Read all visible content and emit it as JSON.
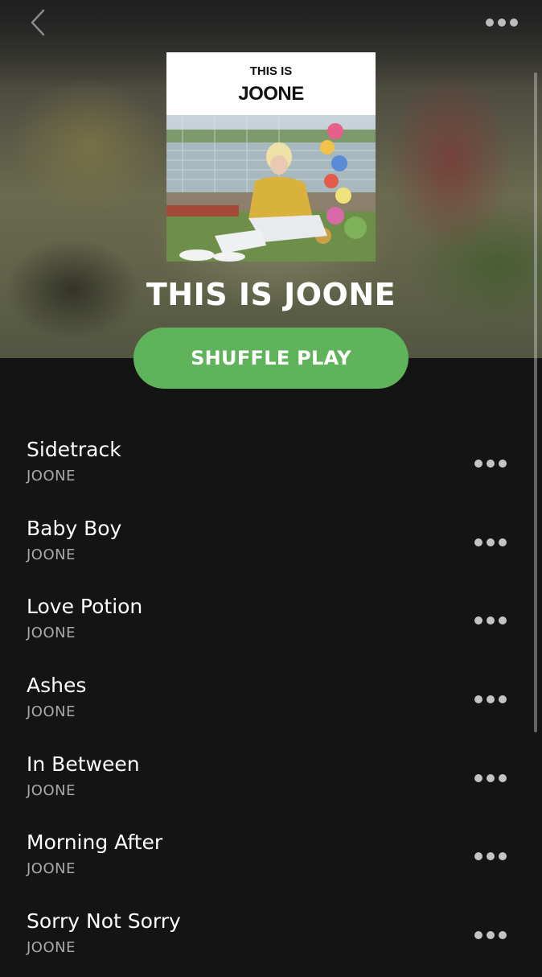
{
  "header": {
    "back_icon": "chevron-left-icon",
    "more_icon": "more-horizontal-icon"
  },
  "cover": {
    "line1": "THIS IS",
    "line2": "JOONE"
  },
  "playlist": {
    "title": "THIS IS JOONE",
    "shuffle_label": "SHUFFLE PLAY",
    "accent_color": "#5fb35b"
  },
  "tracks": [
    {
      "title": "Sidetrack",
      "artist": "JOONE"
    },
    {
      "title": "Baby Boy",
      "artist": "JOONE"
    },
    {
      "title": "Love Potion",
      "artist": "JOONE"
    },
    {
      "title": "Ashes",
      "artist": "JOONE"
    },
    {
      "title": "In Between",
      "artist": "JOONE"
    },
    {
      "title": "Morning After",
      "artist": "JOONE"
    },
    {
      "title": "Sorry Not Sorry",
      "artist": "JOONE"
    }
  ]
}
